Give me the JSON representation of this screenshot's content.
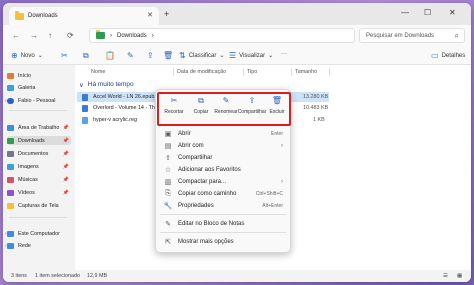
{
  "window": {
    "tab_title": "Downloads",
    "new_tab": "+",
    "minimize": "—",
    "maximize": "☐",
    "close": "✕"
  },
  "nav": {
    "back": "←",
    "forward": "→",
    "up": "↑",
    "refresh": "⟳"
  },
  "address": {
    "path_sep": "›",
    "location": "Downloads",
    "path_sep2": "›"
  },
  "search": {
    "placeholder": "Pesquisar em Downloads"
  },
  "commandbar": {
    "new_label": "Novo",
    "sort_label": "Classificar",
    "view_label": "Visualizar",
    "more": "···",
    "details_label": "Detalhes"
  },
  "sidebar": {
    "items": [
      {
        "label": "Início",
        "icon": "home-icon",
        "color": "#e07b3b"
      },
      {
        "label": "Galeria",
        "icon": "gallery-icon",
        "color": "#3fa0d8"
      },
      {
        "label": "Fabio - Pessoal",
        "icon": "cloud-icon",
        "color": "#2a62c9"
      },
      {
        "label": "Área de Trabalho",
        "icon": "desktop-icon",
        "color": "#3c8fd8"
      },
      {
        "label": "Downloads",
        "icon": "download-icon",
        "color": "#2f9c4e"
      },
      {
        "label": "Documentos",
        "icon": "documents-icon",
        "color": "#6b7b8c"
      },
      {
        "label": "Imagens",
        "icon": "pictures-icon",
        "color": "#3fa0d8"
      },
      {
        "label": "Músicas",
        "icon": "music-icon",
        "color": "#d84f6a"
      },
      {
        "label": "Vídeos",
        "icon": "videos-icon",
        "color": "#8a56c9"
      },
      {
        "label": "Capturas de Tela",
        "icon": "folder-icon",
        "color": "#f2c23e"
      },
      {
        "label": "Este Computador",
        "icon": "computer-icon",
        "color": "#3c8fd8"
      },
      {
        "label": "Rede",
        "icon": "network-icon",
        "color": "#3c8fd8"
      }
    ]
  },
  "columns": {
    "name": "Nome",
    "date": "Data de modificação",
    "type": "Tipo",
    "size": "Tamanho"
  },
  "group": {
    "chevron": "∨",
    "label": "Há muito tempo"
  },
  "files": [
    {
      "name": "Accel World - LN 26.epub",
      "size": "13.280 KB",
      "color": "#3a7bd5"
    },
    {
      "name": "Overlord - Volume 14 - The Wit",
      "size": "10.483 KB",
      "color": "#3a7bd5"
    },
    {
      "name": "hyper-v acrylic.reg",
      "size": "1 KB",
      "color": "#5aa0e6"
    }
  ],
  "context_menu": {
    "quick_actions": [
      {
        "label": "Recortar",
        "icon": "cut-icon",
        "glyph": "✂"
      },
      {
        "label": "Copiar",
        "icon": "copy-icon",
        "glyph": "⧉"
      },
      {
        "label": "Renomear",
        "icon": "rename-icon",
        "glyph": "✎"
      },
      {
        "label": "Compartilhar",
        "icon": "share-icon",
        "glyph": "⇪"
      },
      {
        "label": "Excluir",
        "icon": "delete-icon",
        "glyph": "🗑"
      }
    ],
    "items": [
      {
        "label": "Abrir",
        "shortcut": "Enter",
        "glyph": "▣"
      },
      {
        "label": "Abrir com",
        "shortcut": "",
        "glyph": "▤",
        "arrow": "›"
      },
      {
        "label": "Compartilhar",
        "shortcut": "",
        "glyph": "⇪"
      },
      {
        "label": "Adicionar aos Favoritos",
        "shortcut": "",
        "glyph": "☆"
      },
      {
        "label": "Compactar para...",
        "shortcut": "",
        "glyph": "▥",
        "arrow": "›"
      },
      {
        "label": "Copiar como caminho",
        "shortcut": "Ctrl+Shift+C",
        "glyph": "⎘"
      },
      {
        "label": "Propriedades",
        "shortcut": "Alt+Enter",
        "glyph": "🔧"
      },
      {
        "label": "Editar no Bloco de Notas",
        "shortcut": "",
        "glyph": "✎"
      },
      {
        "label": "Mostrar mais opções",
        "shortcut": "",
        "glyph": "⇱"
      }
    ]
  },
  "status": {
    "count": "3 itens",
    "selected": "1 item selecionado",
    "size": "12,9 MB"
  }
}
